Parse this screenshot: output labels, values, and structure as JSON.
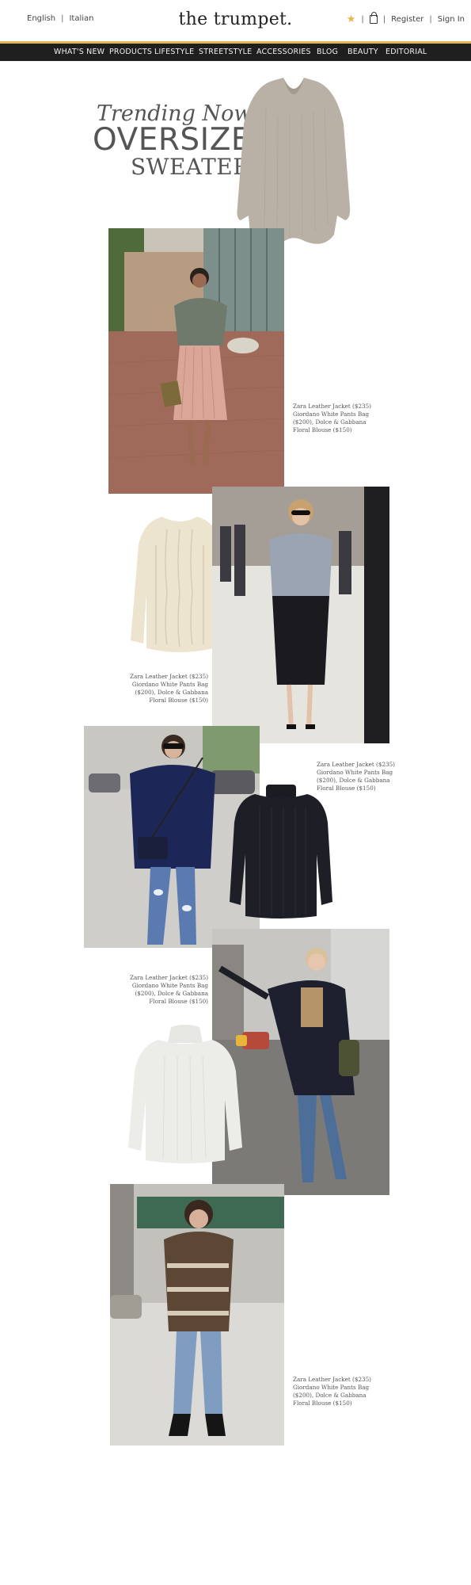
{
  "header": {
    "languages": [
      "English",
      "Italian"
    ],
    "logo": "the trumpet.",
    "account_links": [
      "Register",
      "Sign In"
    ],
    "star_icon": "star-icon",
    "bag_icon": "shopping-bag-icon",
    "accent_color": "#e3b55a"
  },
  "nav": {
    "items": [
      "WHAT'S NEW",
      "PRODUCTS",
      "LIFESTYLE",
      "STREETSTYLE",
      "ACCESSORIES",
      "BLOG",
      "BEAUTY",
      "EDITORIAL"
    ]
  },
  "hero": {
    "line1": "Trending Now",
    "line2": "OVERSIZED",
    "line3": "SWEATERS"
  },
  "looks": [
    {
      "caption": "Zara Leather Jacket ($235) Giordano White Pants Bag ($200), Dolce & Gabbana Floral Blouse ($150)"
    },
    {
      "caption": "Zara Leather Jacket ($235) Giordano White Pants Bag ($200), Dolce & Gabbana Floral Blouse ($150)"
    },
    {
      "caption": "Zara Leather Jacket ($235) Giordano White Pants Bag ($200), Dolce & Gabbana Floral Blouse ($150)"
    },
    {
      "caption": "Zara Leather Jacket ($235) Giordano White Pants Bag ($200), Dolce & Gabbana Floral Blouse ($150)"
    },
    {
      "caption": "Zara Leather Jacket ($235) Giordano White Pants Bag ($200), Dolce & Gabbana Floral Blouse ($150)"
    }
  ]
}
